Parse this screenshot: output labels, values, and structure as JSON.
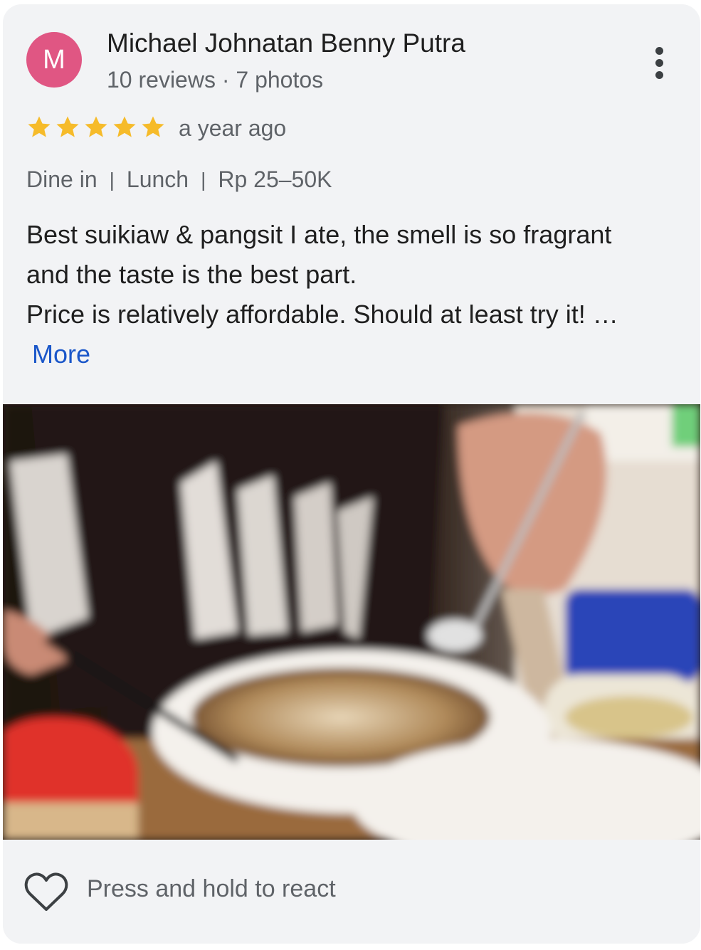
{
  "reviewer": {
    "initial": "M",
    "name": "Michael Johnatan Benny Putra",
    "meta": "10 reviews · 7 photos",
    "avatar_color": "#e05683"
  },
  "review": {
    "rating": 5,
    "max_rating": 5,
    "time": "a year ago",
    "attributes": [
      "Dine in",
      "Lunch",
      "Rp 25–50K"
    ],
    "separator": "|",
    "text_lines": [
      "Best suikiaw & pangsit I ate, the smell is so fragrant",
      "and the taste is the best part.",
      "Price is relatively affordable. Should at least try it! …"
    ],
    "more_label": "More"
  },
  "photo": {
    "icon": "review-photo-image"
  },
  "reaction": {
    "label": "Press and hold to react",
    "icon": "heart-icon"
  },
  "menu": {
    "icon": "more-vert-icon"
  },
  "colors": {
    "star": "#f6bb2a",
    "link": "#1a56c9",
    "card_bg": "#f2f3f5",
    "text_primary": "#1f1f1f",
    "text_secondary": "#5f6368"
  }
}
